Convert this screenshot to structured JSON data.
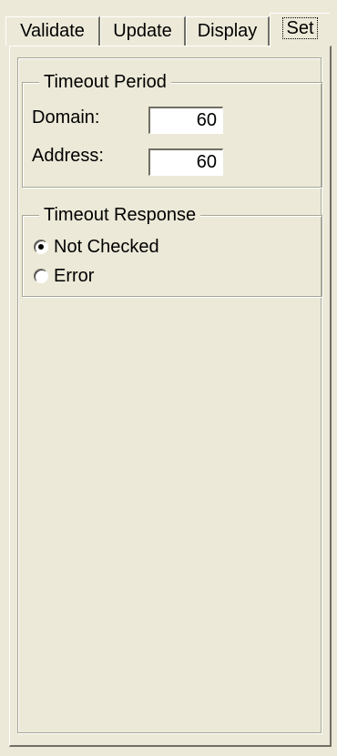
{
  "tabs": [
    {
      "label": "Validate",
      "active": false
    },
    {
      "label": "Update",
      "active": false
    },
    {
      "label": "Display",
      "active": false
    },
    {
      "label": "Set",
      "active": true
    }
  ],
  "timeout_period": {
    "title": "Timeout Period",
    "domain_label": "Domain:",
    "domain_value": "60",
    "address_label": "Address:",
    "address_value": "60"
  },
  "timeout_response": {
    "title": "Timeout Response",
    "options": [
      {
        "label": "Not Checked",
        "selected": true
      },
      {
        "label": "Error",
        "selected": false
      }
    ]
  }
}
